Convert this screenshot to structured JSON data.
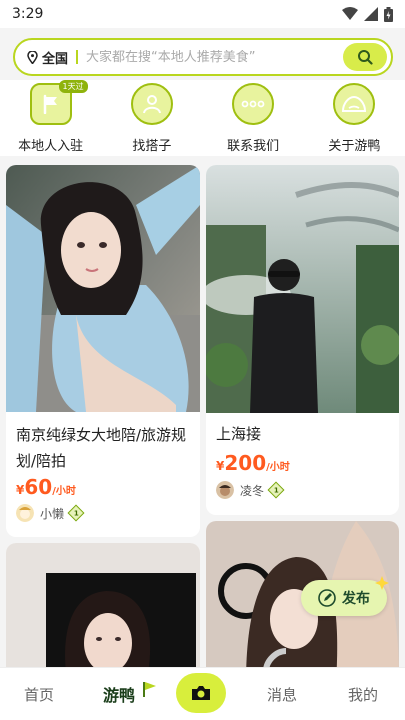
{
  "status_bar": {
    "time": "3:29"
  },
  "search": {
    "location": "全国",
    "placeholder": "大家都在搜“本地人推荐美食”"
  },
  "shortcuts": [
    {
      "label": "本地人入驻",
      "badge": "1天过"
    },
    {
      "label": "找搭子"
    },
    {
      "label": "联系我们"
    },
    {
      "label": "关于游鸭"
    }
  ],
  "cards": [
    {
      "title": "南京纯绿女大地陪/旅游规划/陪拍",
      "price_symbol": "¥",
      "price": "60",
      "unit": "/小时",
      "user_name": "小懒",
      "level": "1"
    },
    {
      "title": "上海接",
      "price_symbol": "¥",
      "price": "200",
      "unit": "/小时",
      "user_name": "凌冬",
      "level": "1"
    }
  ],
  "publish": {
    "label": "发布"
  },
  "tabbar": {
    "home": "首页",
    "youya": "游鸭",
    "messages": "消息",
    "mine": "我的"
  },
  "colors": {
    "accent": "#d8ee3c",
    "accent_border": "#b9d61f",
    "price": "#ff5a1f"
  }
}
